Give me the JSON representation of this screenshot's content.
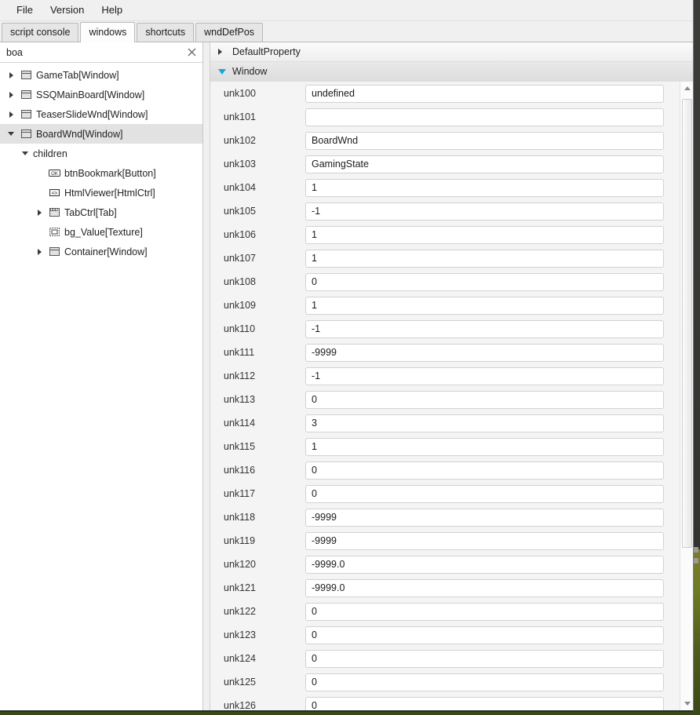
{
  "menu": {
    "items": [
      {
        "label": "File"
      },
      {
        "label": "Version"
      },
      {
        "label": "Help"
      }
    ]
  },
  "tabs": [
    {
      "label": "script console",
      "active": false
    },
    {
      "label": "windows",
      "active": true
    },
    {
      "label": "shortcuts",
      "active": false
    },
    {
      "label": "wndDefPos",
      "active": false
    }
  ],
  "search": {
    "value": "boa",
    "placeholder": "",
    "clear_icon": "close-icon"
  },
  "tree": [
    {
      "label": "GameTab[Window]",
      "indent": 0,
      "twist": "collapsed",
      "icon": "window-icon",
      "selected": false
    },
    {
      "label": "SSQMainBoard[Window]",
      "indent": 0,
      "twist": "collapsed",
      "icon": "window-icon",
      "selected": false
    },
    {
      "label": "TeaserSlideWnd[Window]",
      "indent": 0,
      "twist": "collapsed",
      "icon": "window-icon",
      "selected": false
    },
    {
      "label": "BoardWnd[Window]",
      "indent": 0,
      "twist": "expanded",
      "icon": "window-icon",
      "selected": true
    },
    {
      "label": "children",
      "indent": 1,
      "twist": "expanded",
      "icon": "none",
      "selected": false
    },
    {
      "label": "btnBookmark[Button]",
      "indent": 2,
      "twist": "none",
      "icon": "button-icon",
      "selected": false
    },
    {
      "label": "HtmlViewer[HtmlCtrl]",
      "indent": 2,
      "twist": "none",
      "icon": "html-icon",
      "selected": false
    },
    {
      "label": "TabCtrl[Tab]",
      "indent": 2,
      "twist": "collapsed",
      "icon": "tab-icon",
      "selected": false
    },
    {
      "label": "bg_Value[Texture]",
      "indent": 2,
      "twist": "none",
      "icon": "texture-icon",
      "selected": false
    },
    {
      "label": "Container[Window]",
      "indent": 2,
      "twist": "collapsed",
      "icon": "window-icon",
      "selected": false
    }
  ],
  "groups": [
    {
      "label": "DefaultProperty",
      "expanded": false
    },
    {
      "label": "Window",
      "expanded": true
    }
  ],
  "properties": [
    {
      "name": "unk100",
      "value": "undefined"
    },
    {
      "name": "unk101",
      "value": ""
    },
    {
      "name": "unk102",
      "value": "BoardWnd"
    },
    {
      "name": "unk103",
      "value": "GamingState"
    },
    {
      "name": "unk104",
      "value": "1"
    },
    {
      "name": "unk105",
      "value": "-1"
    },
    {
      "name": "unk106",
      "value": "1"
    },
    {
      "name": "unk107",
      "value": "1"
    },
    {
      "name": "unk108",
      "value": "0"
    },
    {
      "name": "unk109",
      "value": "1"
    },
    {
      "name": "unk110",
      "value": "-1"
    },
    {
      "name": "unk111",
      "value": "-9999"
    },
    {
      "name": "unk112",
      "value": "-1"
    },
    {
      "name": "unk113",
      "value": "0"
    },
    {
      "name": "unk114",
      "value": "3"
    },
    {
      "name": "unk115",
      "value": "1"
    },
    {
      "name": "unk116",
      "value": "0"
    },
    {
      "name": "unk117",
      "value": "0"
    },
    {
      "name": "unk118",
      "value": "-9999"
    },
    {
      "name": "unk119",
      "value": "-9999"
    },
    {
      "name": "unk120",
      "value": "-9999.0"
    },
    {
      "name": "unk121",
      "value": "-9999.0"
    },
    {
      "name": "unk122",
      "value": "0"
    },
    {
      "name": "unk123",
      "value": "0"
    },
    {
      "name": "unk124",
      "value": "0"
    },
    {
      "name": "unk125",
      "value": "0"
    },
    {
      "name": "unk126",
      "value": "0"
    }
  ],
  "scrollbar": {
    "up_icon": "chevron-up-icon",
    "down_icon": "chevron-down-icon"
  },
  "colors": {
    "accent": "#16a8d8",
    "selection": "#e2e2e2",
    "window_bg": "#f0f0f0",
    "panel_bg": "#f4f4f4"
  }
}
